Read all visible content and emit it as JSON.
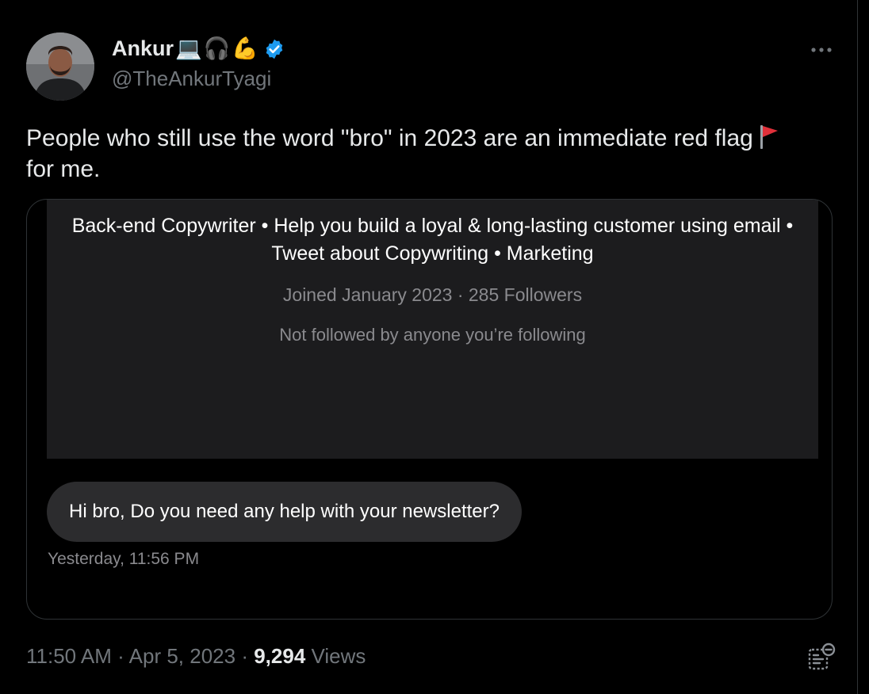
{
  "tweet": {
    "author": {
      "name": "Ankur",
      "name_emojis": [
        "💻",
        "🎧",
        "💪"
      ],
      "handle": "@TheAnkurTyagi",
      "verified": true
    },
    "text": "People who still use the word \"bro\" in 2023 are an immediate red flag",
    "text_continued": "for me.",
    "footer": {
      "time": "11:50 AM",
      "sep1": "·",
      "date": "Apr 5, 2023",
      "sep2": "·",
      "views_count": "9,294",
      "views_label": "Views"
    }
  },
  "screenshot": {
    "bio": "Back-end Copywriter • Help you build a loyal & long-lasting customer using email • Tweet about Copywriting • Marketing",
    "meta": "Joined January 2023 · 285 Followers",
    "mutuals": "Not followed by anyone you’re following",
    "message": "Hi bro, Do you need any help with your newsletter?",
    "message_time": "Yesterday, 11:56 PM"
  },
  "icons": {
    "more": "more-icon",
    "verified": "verified-badge-icon",
    "flag": "red-flag-icon",
    "analytics": "analytics-icon"
  },
  "colors": {
    "background": "#000000",
    "text_primary": "#e7e9ea",
    "text_secondary": "#71767b",
    "verified_blue": "#1d9bf0",
    "flag_red": "#e0303a",
    "bubble": "#2c2c2e",
    "panel": "#1c1c1e"
  }
}
